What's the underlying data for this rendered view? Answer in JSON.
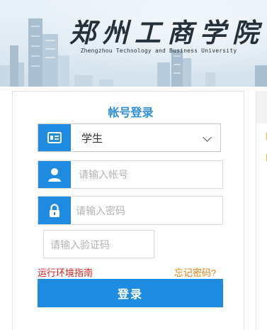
{
  "header": {
    "school_name_cn": "郑州工商学院",
    "school_name_en": "Zhengzhou Technology and Business University"
  },
  "login": {
    "title": "帐号登录",
    "role_select": {
      "value": "学生"
    },
    "account_placeholder": "请输入帐号",
    "password_placeholder": "请输入密码",
    "captcha_placeholder": "请输入验证码",
    "env_guide_link": "运行环境指南",
    "forgot_password_link": "忘记密码?",
    "login_button": "登录"
  },
  "colors": {
    "accent_blue": "#1f8ce1",
    "title_blue": "#2e8de0",
    "guide_red": "#d91f1f",
    "forgot_orange": "#e0801b"
  },
  "icons": [
    "id-card-icon",
    "chevron-down-icon",
    "user-icon",
    "lock-icon"
  ]
}
